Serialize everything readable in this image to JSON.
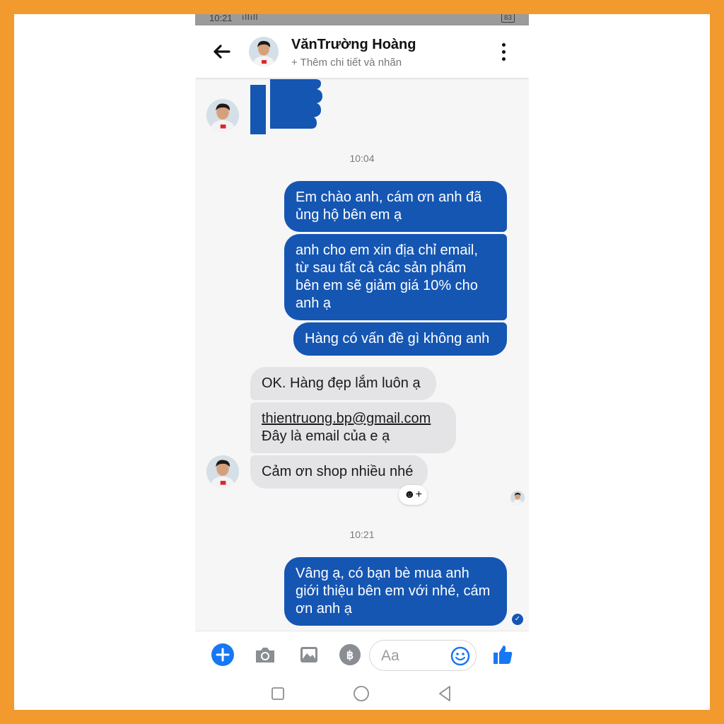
{
  "status_bar": {
    "time": "10:21",
    "signal": "ıllıll",
    "battery": "83"
  },
  "header": {
    "contact_name": "VănTrường Hoàng",
    "subtitle": "+ Thêm chi tiết và nhãn"
  },
  "timestamps": [
    "10:04",
    "10:21"
  ],
  "messages": [
    {
      "dir": "out",
      "text": "Em chào anh, cám ơn anh đã\nủng hộ bên em ạ"
    },
    {
      "dir": "out",
      "text": "anh cho em xin địa chỉ email,\ntừ sau tất cả các sản phẩm\nbên em sẽ giảm giá 10% cho\nanh ạ"
    },
    {
      "dir": "out",
      "text": "Hàng có vấn đề gì không anh"
    },
    {
      "dir": "in",
      "text": "OK. Hàng đẹp lắm luôn ạ"
    },
    {
      "dir": "in",
      "email": "thientruong.bp@gmail.com",
      "text": "Đây là email của e ạ"
    },
    {
      "dir": "in",
      "text": "Cảm ơn shop nhiều nhé"
    },
    {
      "dir": "out",
      "text": "Vâng ạ, có bạn bè mua anh\ngiới thiệu bên em với nhé, cám\nơn anh ạ"
    }
  ],
  "reaction_button": "☻+",
  "composer": {
    "placeholder": "Aa"
  },
  "colors": {
    "frame_border": "#f29a2e",
    "outgoing_bubble": "#1556b3",
    "incoming_bubble": "#e4e4e6",
    "accent": "#1877f2"
  },
  "icons": [
    "back-arrow-icon",
    "more-vert-icon",
    "thumbs-up-icon",
    "plus-icon",
    "camera-icon",
    "image-icon",
    "payment-icon",
    "emoji-icon",
    "like-icon",
    "square-nav-icon",
    "circle-nav-icon",
    "triangle-nav-icon",
    "seen-check-icon"
  ]
}
